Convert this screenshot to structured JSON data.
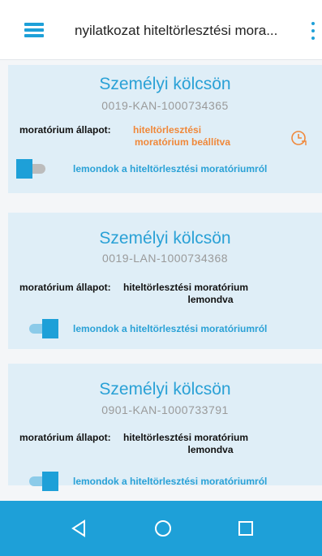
{
  "header": {
    "menu_icon": "hamburger-menu-icon",
    "title": "nyilatkozat hiteltörlesztési mora...",
    "overflow_icon": "more-vertical-icon"
  },
  "cards": [
    {
      "title": "Személyi kölcsön",
      "id": "0019-KAN-1000734365",
      "status_label": "moratórium állapot:",
      "status_line1": "hiteltörlesztési",
      "status_line2": "moratórium beállítva",
      "status_color": "#f0883a",
      "status_icon": "clock-icon",
      "toggle_on": false,
      "toggle_label": "lemondok a hiteltörlesztési moratóriumról"
    },
    {
      "title": "Személyi kölcsön",
      "id": "0019-LAN-1000734368",
      "status_label": "moratórium állapot:",
      "status_line1": "hiteltörlesztési moratórium",
      "status_line2": "lemondva",
      "status_color": "#111111",
      "toggle_on": true,
      "toggle_label": "lemondok a hiteltörlesztési moratóriumról"
    },
    {
      "title": "Személyi kölcsön",
      "id": "0901-KAN-1000733791",
      "status_label": "moratórium állapot:",
      "status_line1": "hiteltörlesztési moratórium",
      "status_line2": "lemondva",
      "status_color": "#111111",
      "toggle_on": true,
      "toggle_label": "lemondok a hiteltörlesztési moratóriumról"
    }
  ],
  "navbar": {
    "back_icon": "back-triangle-icon",
    "home_icon": "home-circle-icon",
    "recents_icon": "recents-square-icon"
  },
  "colors": {
    "accent": "#1ea0d8",
    "card_background": "#dfeef7",
    "status_pending": "#f0883a"
  }
}
